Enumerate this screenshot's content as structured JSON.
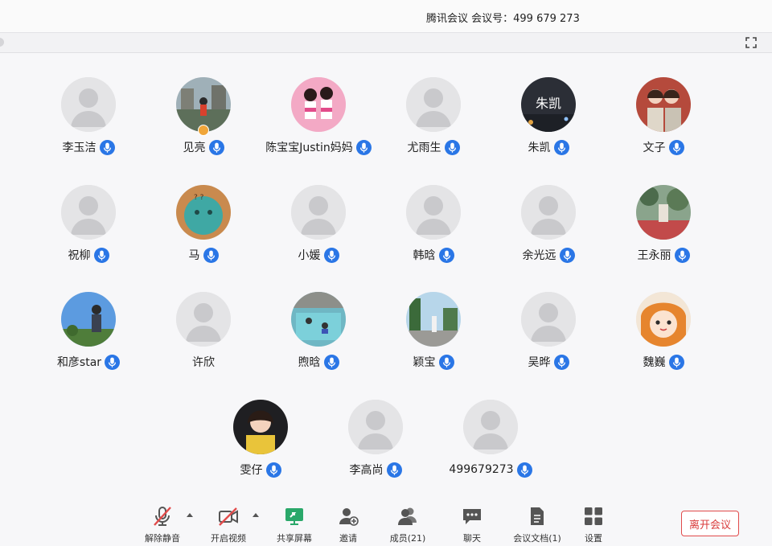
{
  "window": {
    "title": "腾讯会议  会议号：499 679 273"
  },
  "colors": {
    "mic_accent": "#2a76e6",
    "leave_red": "#d93b3b",
    "share_green": "#2aa86a",
    "muted_red": "#e24b4b"
  },
  "participants": [
    {
      "name": "李玉洁",
      "avatar": "default-avatar"
    },
    {
      "name": "见亮",
      "avatar": "photo-avatar",
      "host": true
    },
    {
      "name": "陈宝宝Justin妈妈",
      "avatar": "photo-avatar"
    },
    {
      "name": "尤雨生",
      "avatar": "default-avatar"
    },
    {
      "name": "朱凯",
      "avatar": "photo-avatar"
    },
    {
      "name": "文子",
      "avatar": "photo-avatar"
    },
    {
      "name": "祝柳",
      "avatar": "default-avatar"
    },
    {
      "name": "马",
      "avatar": "photo-avatar"
    },
    {
      "name": "小媛",
      "avatar": "default-avatar"
    },
    {
      "name": "韩晗",
      "avatar": "default-avatar"
    },
    {
      "name": "余光远",
      "avatar": "default-avatar"
    },
    {
      "name": "王永丽",
      "avatar": "photo-avatar"
    },
    {
      "name": "和彦star",
      "avatar": "photo-avatar"
    },
    {
      "name": "许欣",
      "avatar": "default-avatar",
      "no_mic": true
    },
    {
      "name": "煦晗",
      "avatar": "photo-avatar"
    },
    {
      "name": "颖宝",
      "avatar": "photo-avatar"
    },
    {
      "name": "吴晔",
      "avatar": "default-avatar"
    },
    {
      "name": "魏巍",
      "avatar": "photo-avatar"
    },
    {
      "name": "雯仔",
      "avatar": "photo-avatar"
    },
    {
      "name": "李高尚",
      "avatar": "default-avatar"
    },
    {
      "name": "499679273",
      "avatar": "default-avatar"
    }
  ],
  "toolbar": {
    "unmute": "解除静音",
    "start_video": "开启视频",
    "share_screen": "共享屏幕",
    "invite": "邀请",
    "members": "成员(21)",
    "chat": "聊天",
    "docs": "会议文档(1)",
    "settings": "设置",
    "leave": "离开会议"
  }
}
